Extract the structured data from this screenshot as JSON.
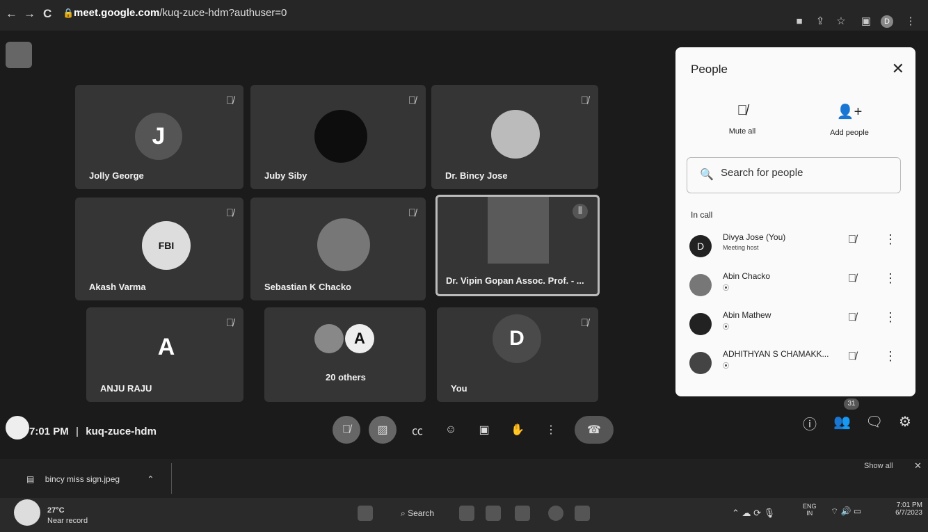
{
  "browser": {
    "url_domain": "meet.google.com",
    "url_path": "/kuq-zuce-hdm?authuser=0",
    "profile_letter": "D"
  },
  "tiles": [
    {
      "name": "Jolly George",
      "initial": "J"
    },
    {
      "name": "Juby Siby",
      "initial": ""
    },
    {
      "name": "Dr. Bincy Jose",
      "initial": ""
    },
    {
      "name": "Akash Varma",
      "initial": "FBI"
    },
    {
      "name": "Sebastian K Chacko",
      "initial": ""
    },
    {
      "name": "Dr. Vipin Gopan Assoc. Prof. - ...",
      "initial": ""
    },
    {
      "name": "ANJU RAJU",
      "initial": "A"
    },
    {
      "name": "20 others",
      "initial": "A"
    },
    {
      "name": "You",
      "initial": "D"
    }
  ],
  "people_panel": {
    "title": "People",
    "mute_all": "Mute all",
    "add_people": "Add people",
    "search_placeholder": "Search for people",
    "section": "In call",
    "participants": [
      {
        "name": "Divya Jose (You)",
        "sub": "Meeting host",
        "initial": "D"
      },
      {
        "name": "Abin Chacko",
        "sub": "",
        "initial": ""
      },
      {
        "name": "Abin Mathew",
        "sub": "",
        "initial": ""
      },
      {
        "name": "ADHITHYAN S CHAMAKK...",
        "sub": "",
        "initial": ""
      }
    ]
  },
  "controls": {
    "time": "7:01 PM",
    "separator": "|",
    "meeting_code": "kuq-zuce-hdm",
    "people_count": "31"
  },
  "downloads": {
    "file": "bincy miss sign.jpeg",
    "show_all": "Show all"
  },
  "taskbar": {
    "temperature": "27°C",
    "weather": "Near record",
    "search": "Search",
    "lang1": "ENG",
    "lang2": "IN",
    "clock_time": "7:01 PM",
    "clock_date": "6/7/2023"
  }
}
